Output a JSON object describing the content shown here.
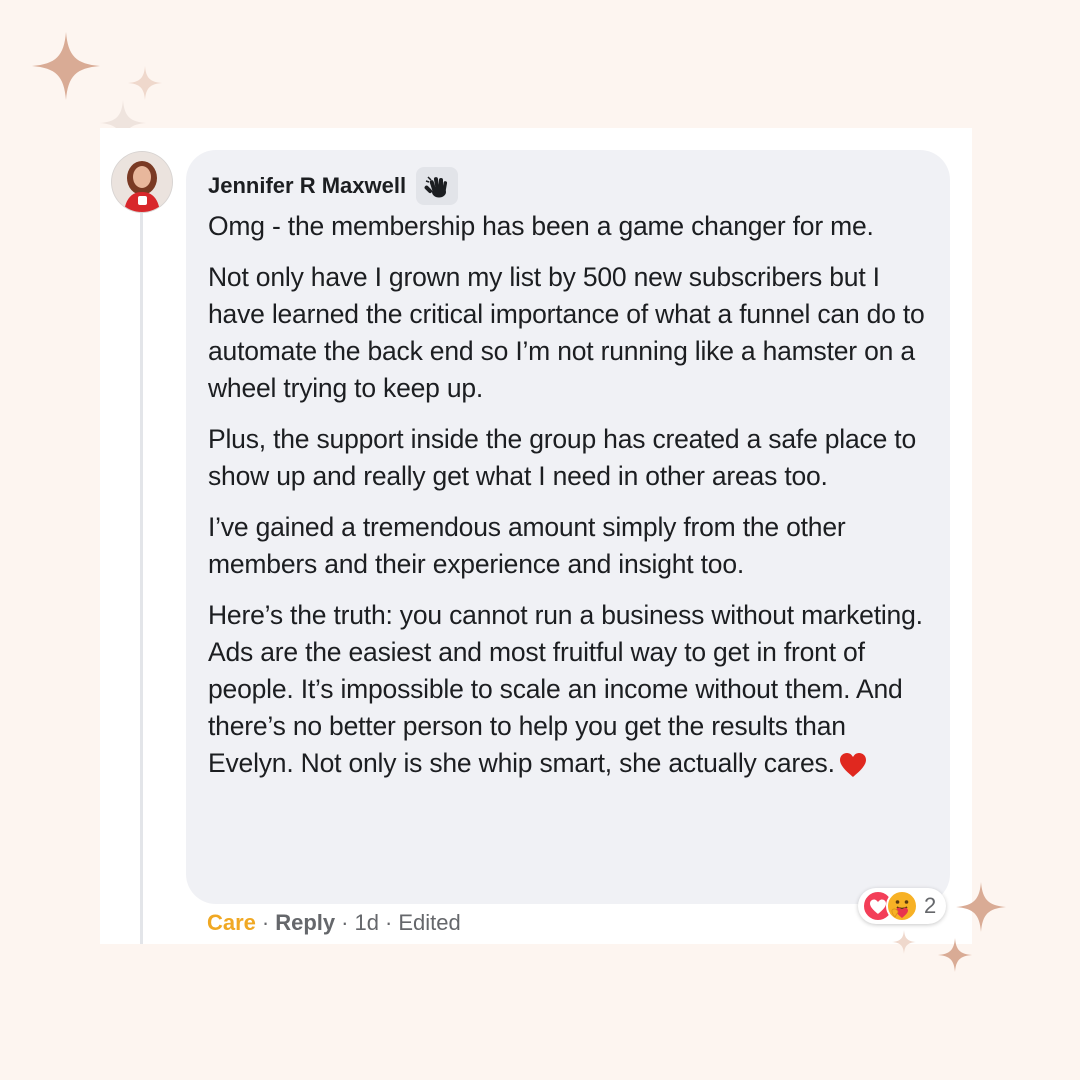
{
  "comment": {
    "author": "Jennifer R Maxwell",
    "badge_icon": "waving-hand-icon",
    "paragraphs": [
      "Omg - the membership has been a game changer for me.",
      "Not only have I grown my list by 500 new subscribers but I have learned the critical importance of what a funnel can do to automate the back end so I’m not running like a hamster on a wheel trying to keep up.",
      "Plus, the support inside the group has created a safe place to show up and really get what I need in other areas too.",
      "I’ve gained a tremendous amount simply from the other members and their experience and insight too.",
      "Here’s the truth: you cannot run a business without marketing. Ads are the easiest and most fruitful way to get in front of people. It’s impossible to scale an income without them. And there’s no better person to help you get the results than Evelyn. Not only is she whip smart, she actually cares."
    ],
    "trailing_emoji": "red-heart-icon"
  },
  "actions": {
    "care": "Care",
    "reply": "Reply",
    "time": "1d",
    "edited": "Edited",
    "separator": "·"
  },
  "reactions": {
    "icons": [
      "love-reaction-icon",
      "care-reaction-icon"
    ],
    "count": "2"
  },
  "colors": {
    "background": "#fdf5f0",
    "bubble": "#f0f1f5",
    "care_accent": "#f0a823",
    "sparkle": "#d9ab95"
  }
}
